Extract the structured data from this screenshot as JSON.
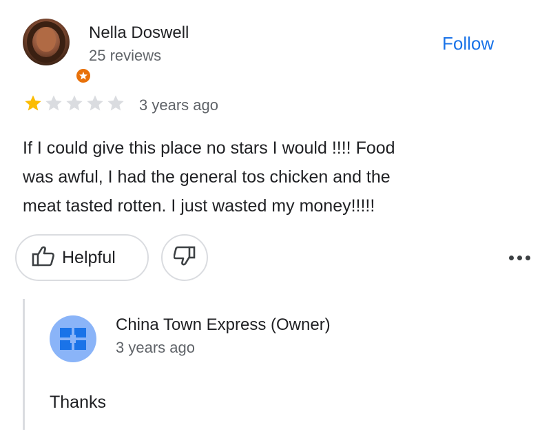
{
  "reviewer": {
    "name": "Nella Doswell",
    "reviews": "25 reviews",
    "follow_label": "Follow"
  },
  "review": {
    "rating": 1,
    "max_rating": 5,
    "time": "3 years ago",
    "text": "If I could give this place no stars I would !!!! Food\nwas awful, I had the general tos chicken and the\nmeat tasted rotten. I just wasted my money!!!!!"
  },
  "actions": {
    "helpful_label": "Helpful"
  },
  "owner_reply": {
    "name": "China Town Express (Owner)",
    "time": "3 years ago",
    "text": "Thanks"
  },
  "colors": {
    "accent": "#1a73e8",
    "star_filled": "#fbbc04",
    "star_empty": "#dadce0",
    "badge": "#e8710a",
    "owner_avatar": "#8ab4f8"
  }
}
